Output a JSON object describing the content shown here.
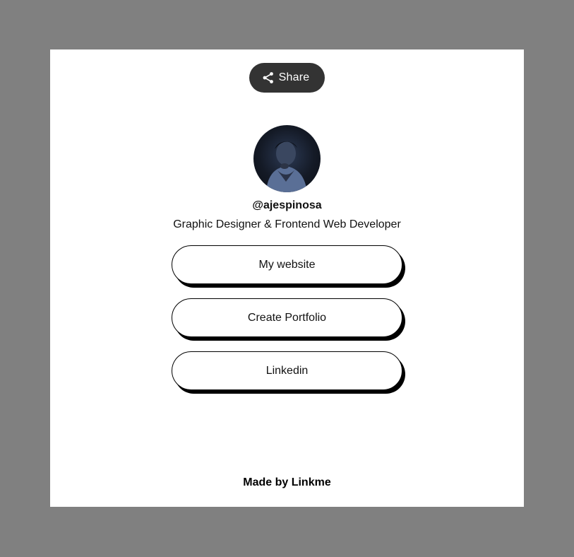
{
  "header": {
    "share_label": "Share",
    "share_icon": "share-icon"
  },
  "profile": {
    "avatar": "profile-photo",
    "username": "@ajespinosa",
    "bio": "Graphic Designer & Frontend Web Developer"
  },
  "links": [
    {
      "label": "My website"
    },
    {
      "label": "Create Portfolio"
    },
    {
      "label": "Linkedin"
    }
  ],
  "footer": {
    "label": "Made by Linkme"
  },
  "colors": {
    "background": "#808080",
    "card": "#ffffff",
    "share_button": "#333333",
    "button_border": "#000000"
  }
}
